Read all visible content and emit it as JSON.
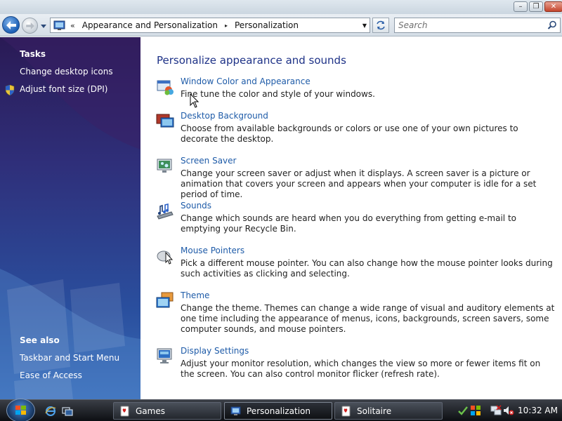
{
  "window": {
    "minimize_label": "–",
    "maximize_label": "❐",
    "close_label": "✕"
  },
  "address": {
    "chevrons": "«",
    "crumbs": [
      "Appearance and Personalization",
      "Personalization"
    ],
    "separator": "▸",
    "dropdown": "▼"
  },
  "search": {
    "placeholder": "Search"
  },
  "taskpane": {
    "tasks_heading": "Tasks",
    "tasks": [
      "Change desktop icons",
      "Adjust font size (DPI)"
    ],
    "see_also_heading": "See also",
    "see_also": [
      "Taskbar and Start Menu",
      "Ease of Access"
    ]
  },
  "main": {
    "title": "Personalize appearance and sounds",
    "items": [
      {
        "title": "Window Color and Appearance",
        "desc": "Fine tune the color and style of your windows.",
        "icon": "window-color-icon"
      },
      {
        "title": "Desktop Background",
        "desc": "Choose from available backgrounds or colors or use one of your own pictures to decorate the desktop.",
        "icon": "desktop-background-icon"
      },
      {
        "title": "Screen Saver",
        "desc": "Change your screen saver or adjust when it displays. A screen saver is a picture or animation that covers your screen and appears when your computer is idle for a set period of time.",
        "icon": "screen-saver-icon"
      },
      {
        "title": "Sounds",
        "desc": "Change which sounds are heard when you do everything from getting e-mail to emptying your Recycle Bin.",
        "icon": "sounds-icon"
      },
      {
        "title": "Mouse Pointers",
        "desc": "Pick a different mouse pointer. You can also change how the mouse pointer looks during such activities as clicking and selecting.",
        "icon": "mouse-icon"
      },
      {
        "title": "Theme",
        "desc": "Change the theme. Themes can change a wide range of visual and auditory elements at one time including the appearance of menus, icons, backgrounds, screen savers, some computer sounds, and mouse pointers.",
        "icon": "theme-icon"
      },
      {
        "title": "Display Settings",
        "desc": "Adjust your monitor resolution, which changes the view so more or fewer items fit on the screen. You can also control monitor flicker (refresh rate).",
        "icon": "display-icon"
      }
    ]
  },
  "taskbar": {
    "buttons": [
      {
        "label": "Games",
        "icon": "games-icon"
      },
      {
        "label": "Personalization",
        "icon": "personalization-icon"
      },
      {
        "label": "Solitaire",
        "icon": "solitaire-icon"
      }
    ],
    "clock": "10:32 AM"
  },
  "colors": {
    "link": "#1e5ba8",
    "heading": "#1e3287",
    "pane_top": "#2a1a55",
    "pane_bottom": "#3a6cb8"
  }
}
